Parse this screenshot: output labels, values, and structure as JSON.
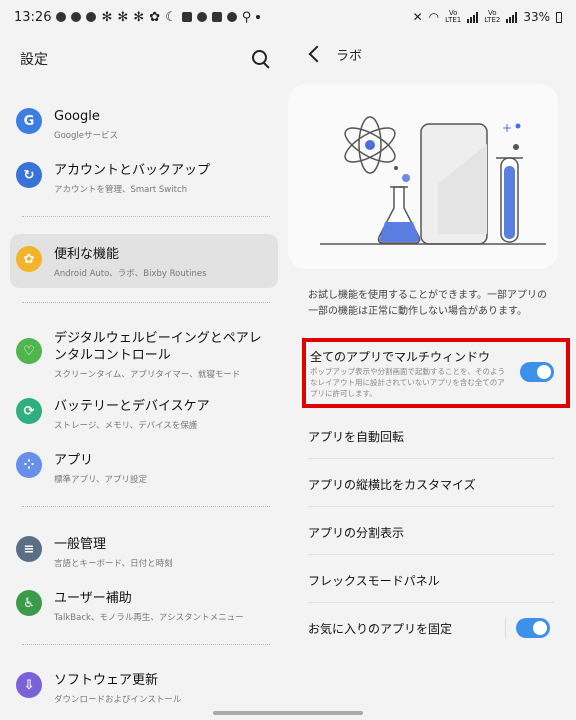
{
  "status": {
    "time": "13:26",
    "battery": "33%",
    "lte1": "Vo))\nLTE1",
    "lte2": "Vo))\nLTE2"
  },
  "left": {
    "title": "設定",
    "items": [
      {
        "title": "Google",
        "sub": "Googleサービス",
        "icon": "G",
        "color": "#3c7fe0"
      },
      {
        "title": "アカウントとバックアップ",
        "sub": "アカウントを管理、Smart Switch",
        "icon": "↻",
        "color": "#3973d8"
      },
      {
        "title": "便利な機能",
        "sub": "Android Auto、ラボ、Bixby Routines",
        "icon": "✿",
        "color": "#f3b32a"
      },
      {
        "title": "デジタルウェルビーイングとペアレンタルコントロール",
        "sub": "スクリーンタイム、アプリタイマー、就寝モード",
        "icon": "♡",
        "color": "#4fb54c"
      },
      {
        "title": "バッテリーとデバイスケア",
        "sub": "ストレージ、メモリ、デバイスを保護",
        "icon": "⟳",
        "color": "#2fae82"
      },
      {
        "title": "アプリ",
        "sub": "標準アプリ、アプリ設定",
        "icon": "⁘",
        "color": "#6a8fe8"
      },
      {
        "title": "一般管理",
        "sub": "言語とキーボード、日付と時刻",
        "icon": "≡",
        "color": "#5a6f86"
      },
      {
        "title": "ユーザー補助",
        "sub": "TalkBack、モノラル再生、アシスタントメニュー",
        "icon": "♿",
        "color": "#3b9b4a"
      },
      {
        "title": "ソフトウェア更新",
        "sub": "ダウンロードおよびインストール",
        "icon": "⇩",
        "color": "#7a62d8"
      }
    ]
  },
  "right": {
    "title": "ラボ",
    "description": "お試し機能を使用することができます。一部アプリの一部の機能は正常に動作しない場合があります。",
    "highlight_title": "全てのアプリでマルチウィンドウ",
    "highlight_sub": "ポップアップ表示や分割画面で起動することを、そのようなレイアウト用に設計されていないアプリを含む全てのアプリに許可します。",
    "rows": [
      {
        "label": "アプリを自動回転"
      },
      {
        "label": "アプリの縦横比をカスタマイズ"
      },
      {
        "label": "アプリの分割表示"
      },
      {
        "label": "フレックスモードパネル"
      },
      {
        "label": "お気に入りのアプリを固定"
      }
    ]
  }
}
